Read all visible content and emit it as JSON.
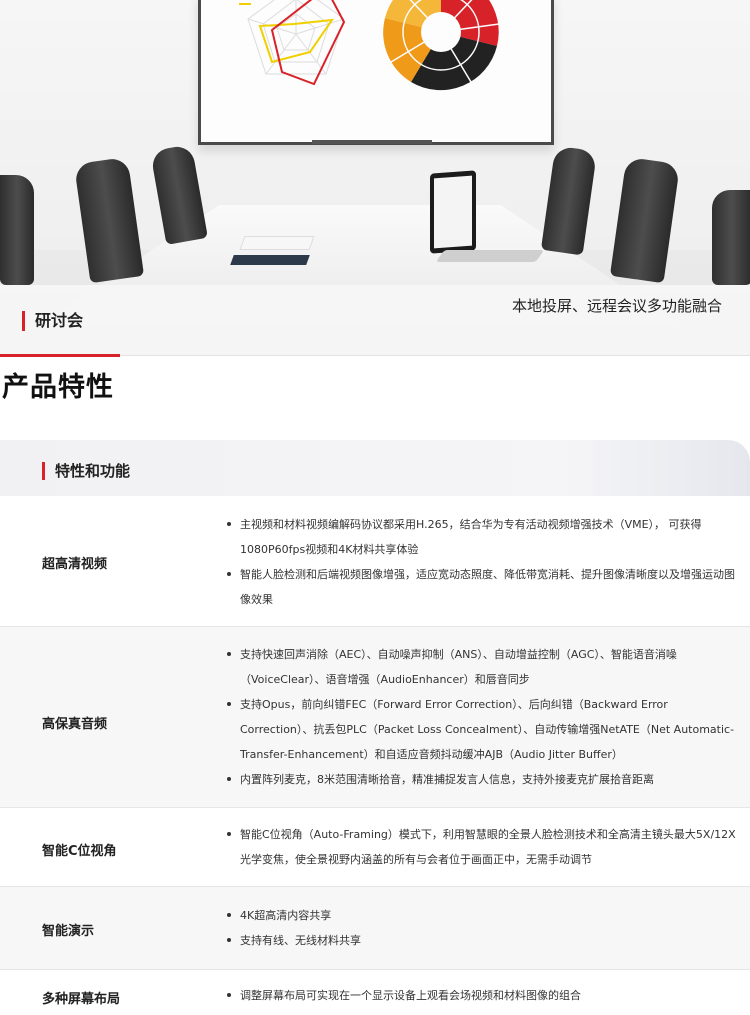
{
  "hero": {
    "scene_label": "研讨会",
    "caption": "本地投屏、远程会议多功能融合"
  },
  "section": {
    "title": "产品特性",
    "subtitle": "特性和功能"
  },
  "features": [
    {
      "name": "超高清视频",
      "items": [
        "主视频和材料视频编解码协议都采用H.265，结合华为专有活动视频增强技术（VME）， 可获得1080P60fps视频和4K材料共享体验",
        "智能人脸检测和后端视频图像增强，适应宽动态照度、降低带宽消耗、提升图像清晰度以及增强运动图像效果"
      ]
    },
    {
      "name": "高保真音频",
      "items": [
        "支持快速回声消除（AEC）、自动噪声抑制（ANS）、自动增益控制（AGC）、智能语音消噪（VoiceClear）、语音增强（AudioEnhancer）和唇音同步",
        "支持Opus，前向纠错FEC（Forward Error Correction）、后向纠错（Backward Error Correction）、抗丢包PLC（Packet Loss Concealment）、自动传输增强NetATE（Net Automatic-Transfer-Enhancement）和自适应音频抖动缓冲AJB（Audio Jitter Buffer）",
        "内置阵列麦克，8米范围清晰拾音，精准捕捉发言人信息，支持外接麦克扩展拾音距离"
      ]
    },
    {
      "name": "智能C位视角",
      "items": [
        "智能C位视角（Auto-Framing）模式下，利用智慧眼的全景人脸检测技术和全高清主镜头最大5X/12X光学变焦，使全景视野内涵盖的所有与会者位于画面正中，无需手动调节"
      ]
    },
    {
      "name": "智能演示",
      "items": [
        "4K超高清内容共享",
        "支持有线、无线材料共享"
      ]
    },
    {
      "name": "多种屏幕布局",
      "items": [
        "调整屏幕布局可实现在一个显示设备上观看会场视频和材料图像的组合"
      ]
    }
  ],
  "colors": {
    "accent": "#d8222a",
    "row_alt": "#f7f7f7"
  }
}
